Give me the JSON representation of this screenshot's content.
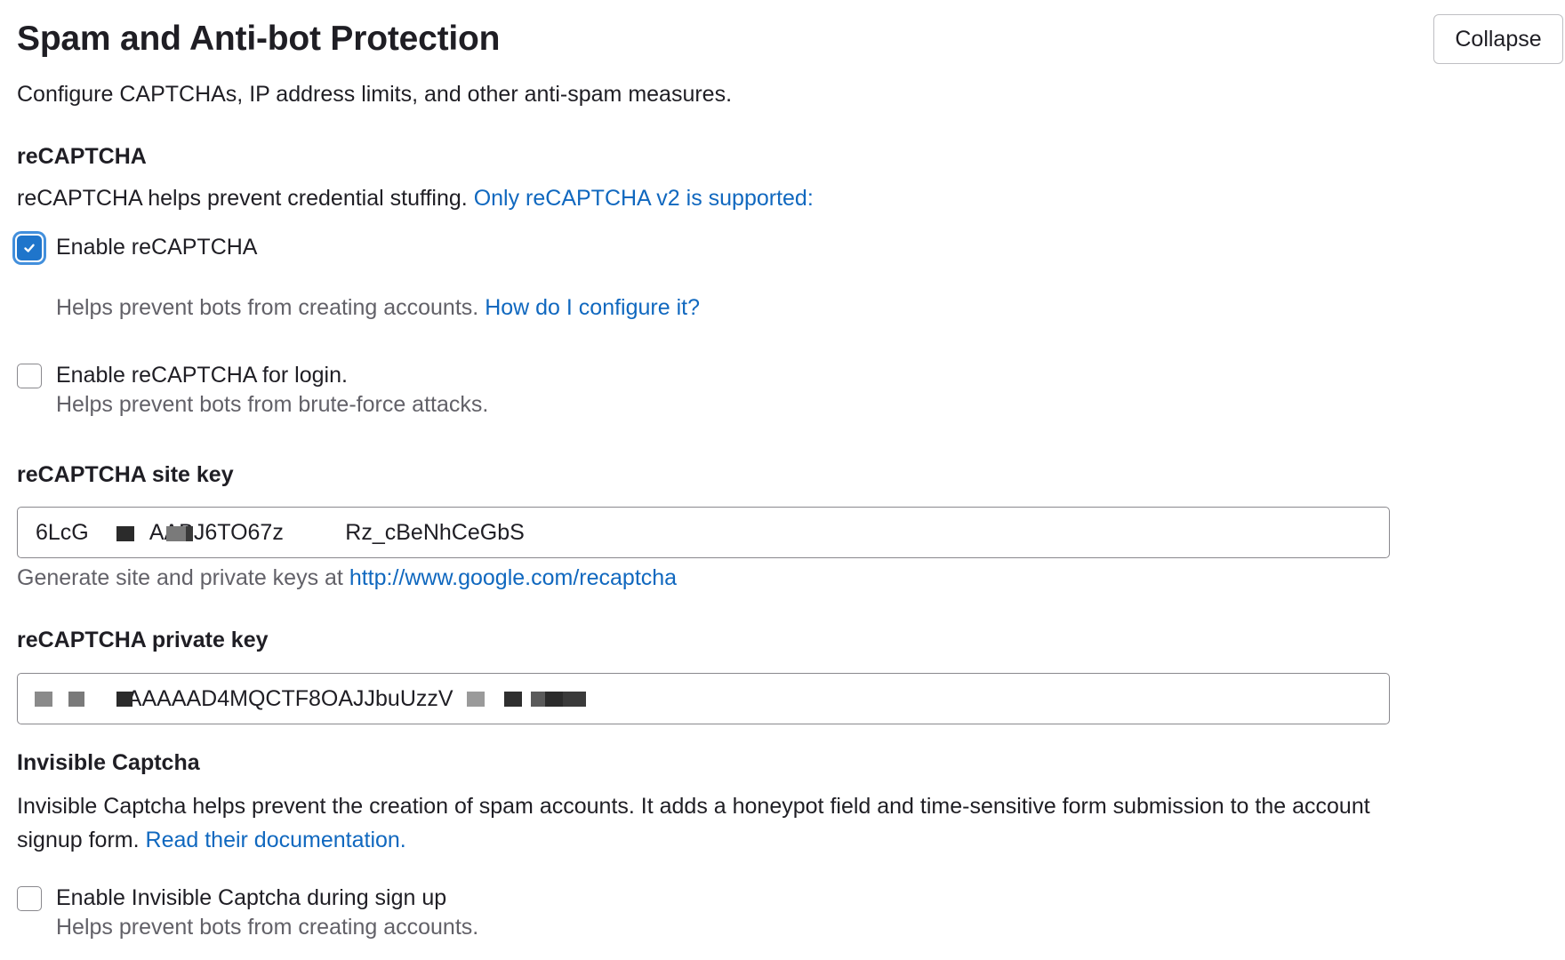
{
  "section": {
    "title": "Spam and Anti-bot Protection",
    "description": "Configure CAPTCHAs, IP address limits, and other anti-spam measures.",
    "collapse_label": "Collapse"
  },
  "recaptcha": {
    "heading": "reCAPTCHA",
    "description": "reCAPTCHA helps prevent credential stuffing. ",
    "description_link": "Only reCAPTCHA v2 is supported:",
    "enable": {
      "checked": true,
      "label": "Enable reCAPTCHA",
      "help": "Helps prevent bots from creating accounts. ",
      "help_link": "How do I configure it?"
    },
    "enable_login": {
      "checked": false,
      "label": "Enable reCAPTCHA for login.",
      "help": "Helps prevent bots from brute-force attacks."
    },
    "site_key": {
      "label": "reCAPTCHA site key",
      "value": "6LcG          AABJ6TO67z          Rz_cBeNhCeGbS",
      "help": "Generate site and private keys at ",
      "help_link": "http://www.google.com/recaptcha"
    },
    "private_key": {
      "label": "reCAPTCHA private key",
      "value": "               AAAAAD4MQCTF8OAJJbuUzzV"
    }
  },
  "invisible_captcha": {
    "heading": "Invisible Captcha",
    "description": "Invisible Captcha helps prevent the creation of spam accounts. It adds a honeypot field and time-sensitive form submission to the account signup form. ",
    "description_link": "Read their documentation.",
    "enable": {
      "checked": false,
      "label": "Enable Invisible Captcha during sign up",
      "help": "Helps prevent bots from creating accounts."
    }
  },
  "colors": {
    "link": "#1068bf",
    "checkbox_checked": "#1f75cb",
    "text": "#1f1e24",
    "muted_text": "#626168"
  },
  "icons": {
    "checkmark": "check-icon"
  }
}
